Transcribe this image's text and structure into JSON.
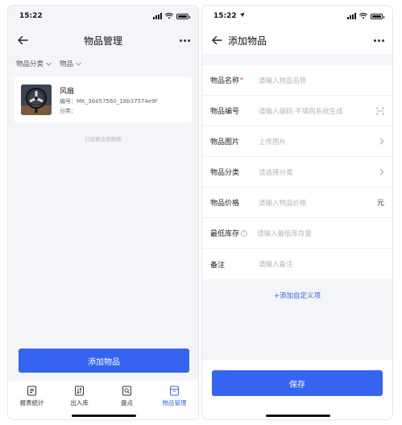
{
  "left": {
    "status_time": "15:22",
    "title": "物品管理",
    "filters": [
      "物品分类",
      "物品"
    ],
    "item": {
      "name": "风扇",
      "code": "编号：MK_36457560_18b37574e9f",
      "category": "分类："
    },
    "loaded_text": "已加载全部数据",
    "add_button": "添加物品",
    "tabs": [
      {
        "label": "报表统计",
        "icon": "report-icon"
      },
      {
        "label": "出入库",
        "icon": "inout-icon"
      },
      {
        "label": "盘点",
        "icon": "inventory-icon"
      },
      {
        "label": "物品管理",
        "icon": "goods-icon"
      }
    ],
    "active_tab": "物品管理",
    "accent": "#3565f0"
  },
  "right": {
    "status_time": "15:22",
    "title": "添加物品",
    "fields": [
      {
        "label": "物品名称",
        "placeholder": "请输入物品名称",
        "required": "*"
      },
      {
        "label": "物品编号",
        "placeholder": "请输入编码 不填则系统生成"
      },
      {
        "label": "物品图片",
        "placeholder": "上传图片"
      },
      {
        "label": "物品分类",
        "placeholder": "请选择分类"
      },
      {
        "label": "物品价格",
        "placeholder": "请输入物品价格",
        "unit": "元"
      },
      {
        "label": "最低库存",
        "placeholder": "请输入最低库存量",
        "help": "?"
      },
      {
        "label": "备注",
        "placeholder": "请输入备注"
      }
    ],
    "add_custom": "+添加自定义项",
    "save_button": "保存"
  }
}
